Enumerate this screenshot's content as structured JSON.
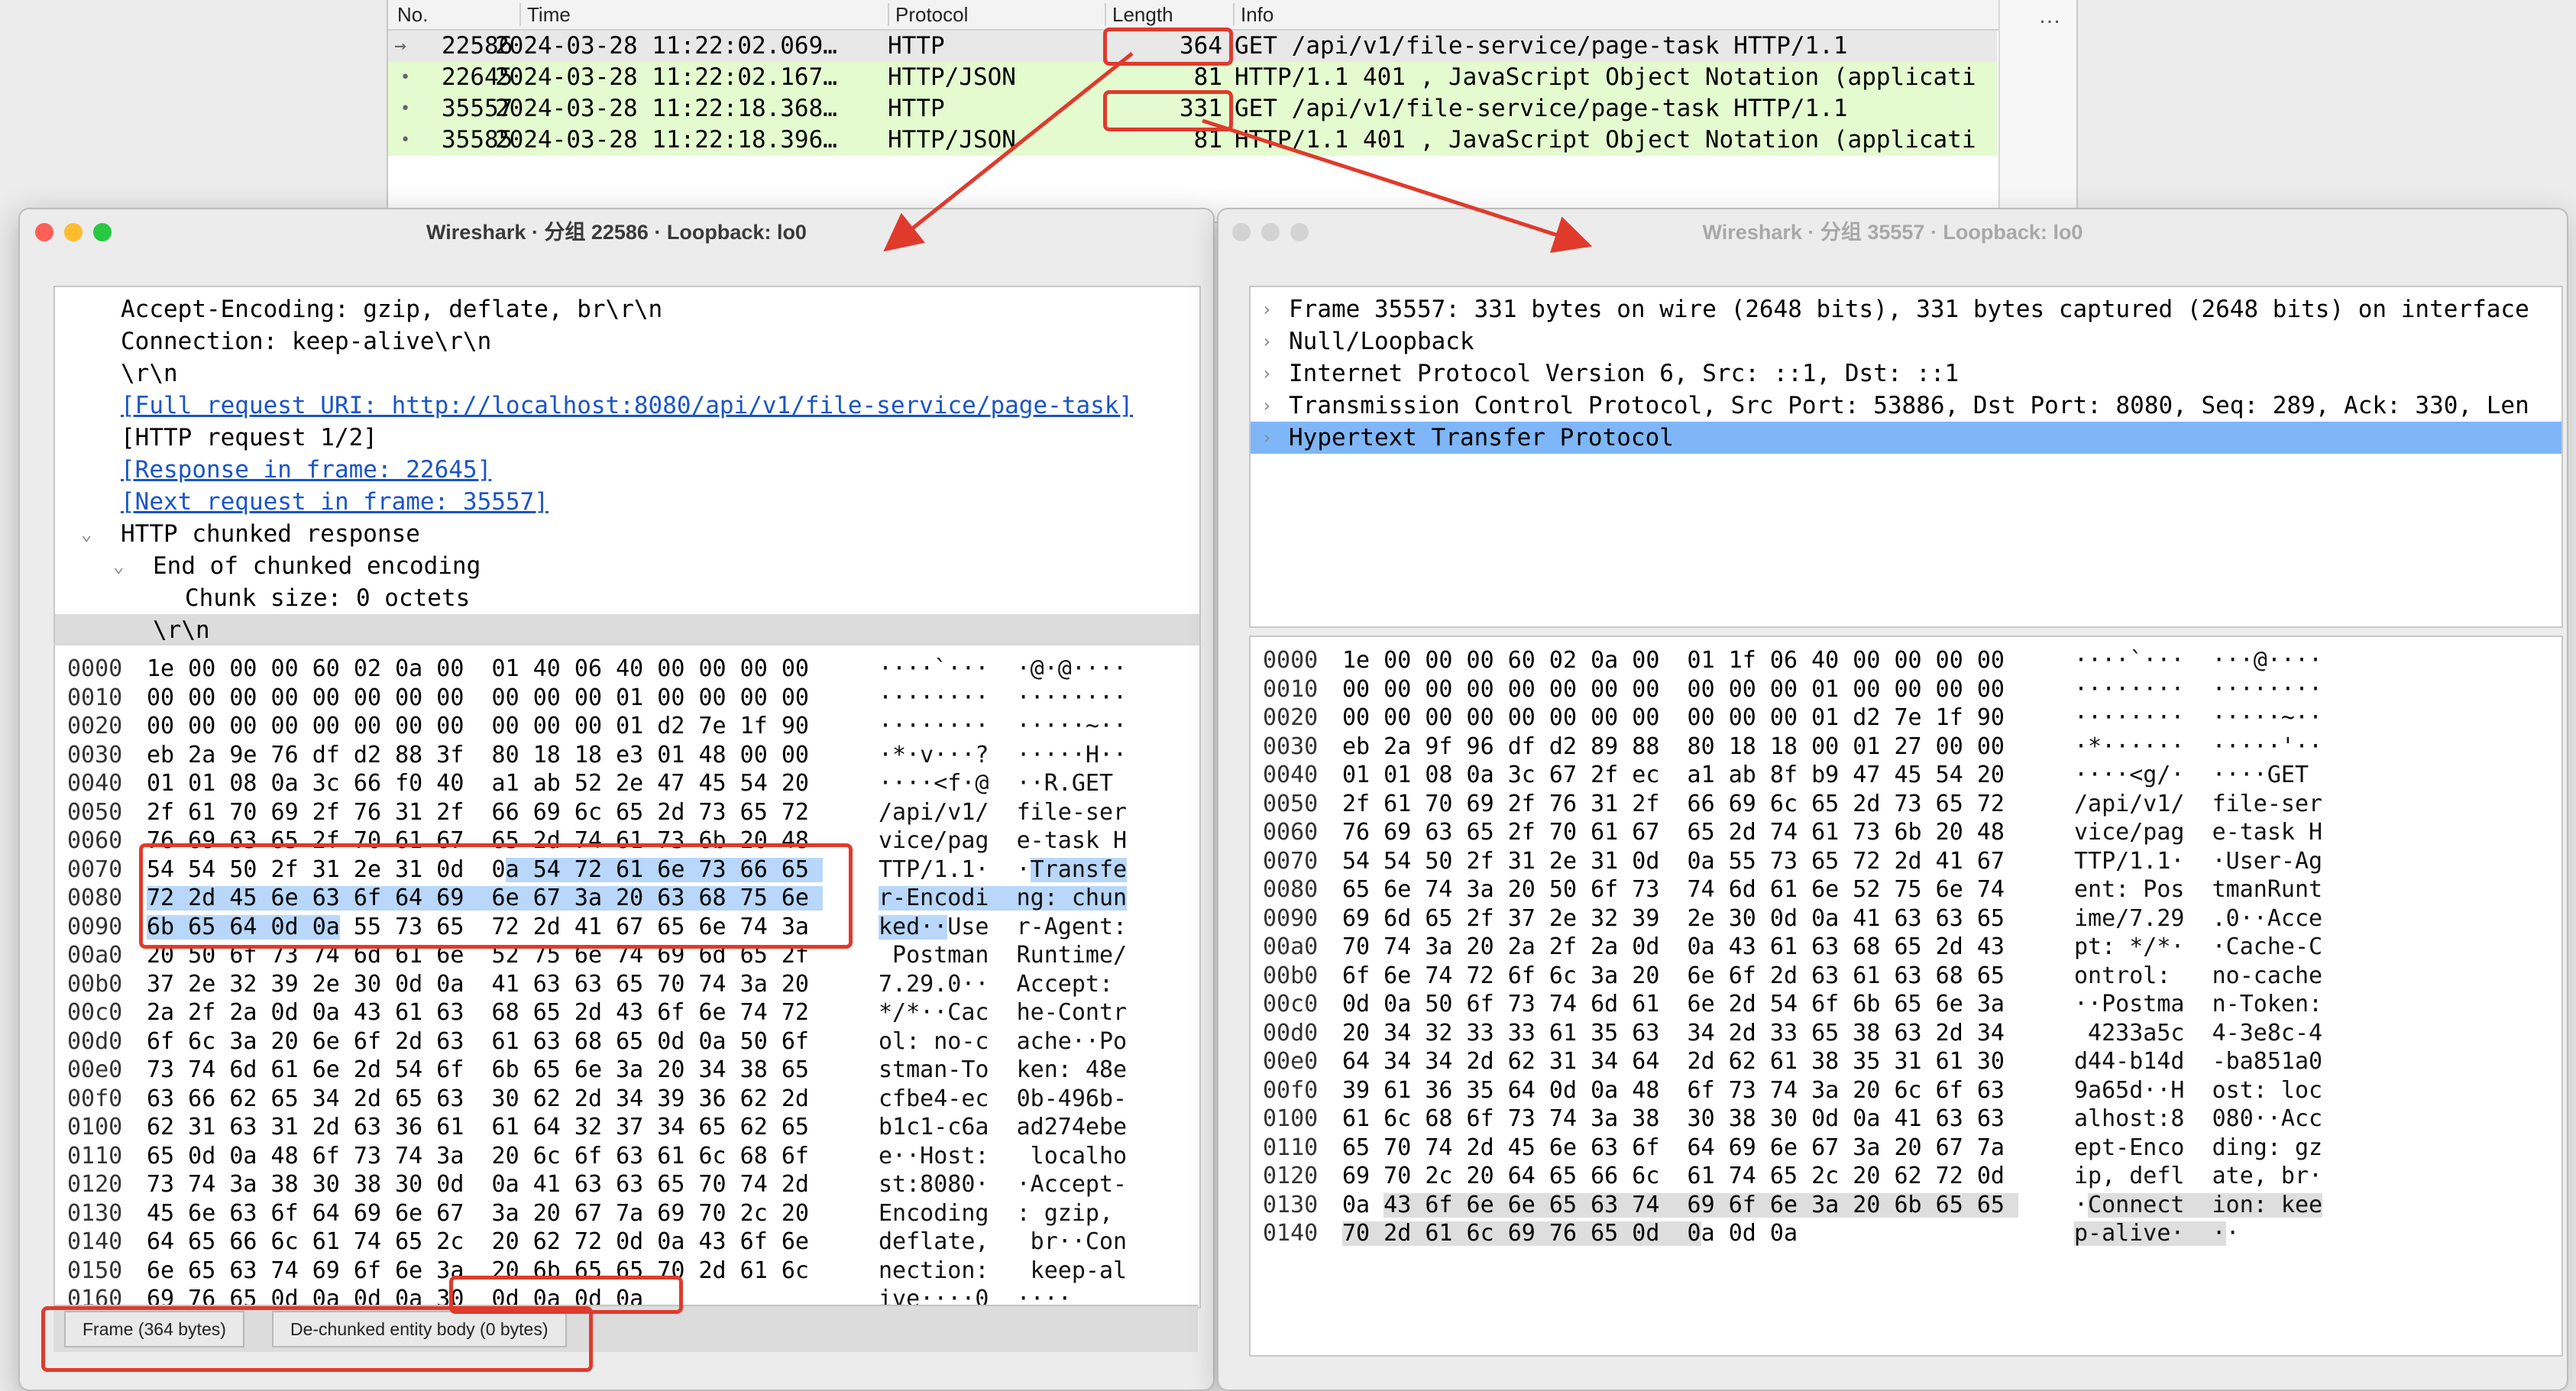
{
  "packet_list": {
    "columns": [
      "No.",
      "Time",
      "Protocol",
      "Length",
      "Info"
    ],
    "rows": [
      {
        "no": "22586",
        "time": "2024-03-28 11:22:02.069…",
        "protocol": "HTTP",
        "length": "364",
        "info": "GET /api/v1/file-service/page-task HTTP/1.1",
        "selected": true
      },
      {
        "no": "22645",
        "time": "2024-03-28 11:22:02.167…",
        "protocol": "HTTP/JSON",
        "length": "81",
        "info": "HTTP/1.1 401  , JavaScript Object Notation (applicati"
      },
      {
        "no": "35557",
        "time": "2024-03-28 11:22:18.368…",
        "protocol": "HTTP",
        "length": "331",
        "info": "GET /api/v1/file-service/page-task HTTP/1.1"
      },
      {
        "no": "35585",
        "time": "2024-03-28 11:22:18.396…",
        "protocol": "HTTP/JSON",
        "length": "81",
        "info": "HTTP/1.1 401  , JavaScript Object Notation (applicati"
      }
    ],
    "more": "…"
  },
  "colors": {
    "accent_red": "#e03a2c",
    "row_green": "#e4fbd0",
    "selection_blue": "#7fb6f7",
    "link_blue": "#1a55c8"
  },
  "left_window": {
    "title": "Wireshark · 分组 22586 · Loopback: lo0",
    "tree": [
      {
        "text": "Accept-Encoding: gzip, deflate, br\\r\\n",
        "indent": 1
      },
      {
        "text": "Connection: keep-alive\\r\\n",
        "indent": 1
      },
      {
        "text": "\\r\\n",
        "indent": 1
      },
      {
        "text": "[Full request URI: http://localhost:8080/api/v1/file-service/page-task]",
        "indent": 1,
        "link": true
      },
      {
        "text": "[HTTP request 1/2]",
        "indent": 1
      },
      {
        "text": "[Response in frame: 22645]",
        "indent": 1,
        "link": true
      },
      {
        "text": "[Next request in frame: 35557]",
        "indent": 1,
        "link": true
      },
      {
        "text": "HTTP chunked response",
        "indent": 1,
        "expander": "down"
      },
      {
        "text": "End of chunked encoding",
        "indent": 2,
        "expander": "down"
      },
      {
        "text": "Chunk size: 0 octets",
        "indent": 3
      },
      {
        "text": "\\r\\n",
        "indent": 2,
        "highlight": true
      }
    ],
    "hex": [
      {
        "off": "0000",
        "hex": "1e 00 00 00 60 02 0a 00  01 40 06 40 00 00 00 00",
        "ascii": "····`···  ·@·@····"
      },
      {
        "off": "0010",
        "hex": "00 00 00 00 00 00 00 00  00 00 00 01 00 00 00 00",
        "ascii": "········  ········"
      },
      {
        "off": "0020",
        "hex": "00 00 00 00 00 00 00 00  00 00 00 01 d2 7e 1f 90",
        "ascii": "········  ·····~··"
      },
      {
        "off": "0030",
        "hex": "eb 2a 9e 76 df d2 88 3f  80 18 18 e3 01 48 00 00",
        "ascii": "·*·v···?  ·····H··"
      },
      {
        "off": "0040",
        "hex": "01 01 08 0a 3c 66 f0 40  a1 ab 52 2e 47 45 54 20",
        "ascii": "····<f·@  ··R.GET "
      },
      {
        "off": "0050",
        "hex": "2f 61 70 69 2f 76 31 2f  66 69 6c 65 2d 73 65 72",
        "ascii": "/api/v1/  file-ser"
      },
      {
        "off": "0060",
        "hex": "76 69 63 65 2f 70 61 67  65 2d 74 61 73 6b 20 48",
        "ascii": "vice/pag  e-task H"
      },
      {
        "off": "0070",
        "hex": "54 54 50 2f 31 2e 31 0d  0a 54 72 61 6e 73 66 65",
        "ascii": "TTP/1.1·  ·Transfe",
        "hl": "partial"
      },
      {
        "off": "0080",
        "hex": "72 2d 45 6e 63 6f 64 69  6e 67 3a 20 63 68 75 6e",
        "ascii": "r-Encodi  ng: chun",
        "hl": "full"
      },
      {
        "off": "0090",
        "hex": "6b 65 64 0d 0a 55 73 65  72 2d 41 67 65 6e 74 3a",
        "ascii": "ked··Use  r-Agent:",
        "hl": "start"
      },
      {
        "off": "00a0",
        "hex": "20 50 6f 73 74 6d 61 6e  52 75 6e 74 69 6d 65 2f",
        "ascii": " Postman  Runtime/"
      },
      {
        "off": "00b0",
        "hex": "37 2e 32 39 2e 30 0d 0a  41 63 63 65 70 74 3a 20",
        "ascii": "7.29.0··  Accept: "
      },
      {
        "off": "00c0",
        "hex": "2a 2f 2a 0d 0a 43 61 63  68 65 2d 43 6f 6e 74 72",
        "ascii": "*/*··Cac  he-Contr"
      },
      {
        "off": "00d0",
        "hex": "6f 6c 3a 20 6e 6f 2d 63  61 63 68 65 0d 0a 50 6f",
        "ascii": "ol: no-c  ache··Po"
      },
      {
        "off": "00e0",
        "hex": "73 74 6d 61 6e 2d 54 6f  6b 65 6e 3a 20 34 38 65",
        "ascii": "stman-To  ken: 48e"
      },
      {
        "off": "00f0",
        "hex": "63 66 62 65 34 2d 65 63  30 62 2d 34 39 36 62 2d",
        "ascii": "cfbe4-ec  0b-496b-"
      },
      {
        "off": "0100",
        "hex": "62 31 63 31 2d 63 36 61  61 64 32 37 34 65 62 65",
        "ascii": "b1c1-c6a  ad274ebe"
      },
      {
        "off": "0110",
        "hex": "65 0d 0a 48 6f 73 74 3a  20 6c 6f 63 61 6c 68 6f",
        "ascii": "e··Host:   localho"
      },
      {
        "off": "0120",
        "hex": "73 74 3a 38 30 38 30 0d  0a 41 63 63 65 70 74 2d",
        "ascii": "st:8080·  ·Accept-"
      },
      {
        "off": "0130",
        "hex": "45 6e 63 6f 64 69 6e 67  3a 20 67 7a 69 70 2c 20",
        "ascii": "Encoding  : gzip, "
      },
      {
        "off": "0140",
        "hex": "64 65 66 6c 61 74 65 2c  20 62 72 0d 0a 43 6f 6e",
        "ascii": "deflate,   br··Con"
      },
      {
        "off": "0150",
        "hex": "6e 65 63 74 69 6f 6e 3a  20 6b 65 65 70 2d 61 6c",
        "ascii": "nection:   keep-al"
      },
      {
        "off": "0160",
        "hex": "69 76 65 0d 0a 0d 0a 30  0d 0a 0d 0a",
        "ascii": "ive····0  ····"
      }
    ],
    "tabs": [
      "Frame (364 bytes)",
      "De-chunked entity body (0 bytes)"
    ]
  },
  "right_window": {
    "title": "Wireshark · 分组 35557 · Loopback: lo0",
    "tree": [
      {
        "text": "Frame 35557: 331 bytes on wire (2648 bits), 331 bytes captured (2648 bits) on interface"
      },
      {
        "text": "Null/Loopback"
      },
      {
        "text": "Internet Protocol Version 6, Src: ::1, Dst: ::1"
      },
      {
        "text": "Transmission Control Protocol, Src Port: 53886, Dst Port: 8080, Seq: 289, Ack: 330, Len"
      },
      {
        "text": "Hypertext Transfer Protocol",
        "selected": true
      }
    ],
    "hex": [
      {
        "off": "0000",
        "hex": "1e 00 00 00 60 02 0a 00  01 1f 06 40 00 00 00 00",
        "ascii": "····`···  ···@····"
      },
      {
        "off": "0010",
        "hex": "00 00 00 00 00 00 00 00  00 00 00 01 00 00 00 00",
        "ascii": "········  ········"
      },
      {
        "off": "0020",
        "hex": "00 00 00 00 00 00 00 00  00 00 00 01 d2 7e 1f 90",
        "ascii": "········  ·····~··"
      },
      {
        "off": "0030",
        "hex": "eb 2a 9f 96 df d2 89 88  80 18 18 00 01 27 00 00",
        "ascii": "·*······  ·····'··"
      },
      {
        "off": "0040",
        "hex": "01 01 08 0a 3c 67 2f ec  a1 ab 8f b9 47 45 54 20",
        "ascii": "····<g/·  ····GET "
      },
      {
        "off": "0050",
        "hex": "2f 61 70 69 2f 76 31 2f  66 69 6c 65 2d 73 65 72",
        "ascii": "/api/v1/  file-ser"
      },
      {
        "off": "0060",
        "hex": "76 69 63 65 2f 70 61 67  65 2d 74 61 73 6b 20 48",
        "ascii": "vice/pag  e-task H"
      },
      {
        "off": "0070",
        "hex": "54 54 50 2f 31 2e 31 0d  0a 55 73 65 72 2d 41 67",
        "ascii": "TTP/1.1·  ·User-Ag"
      },
      {
        "off": "0080",
        "hex": "65 6e 74 3a 20 50 6f 73  74 6d 61 6e 52 75 6e 74",
        "ascii": "ent: Pos  tmanRunt"
      },
      {
        "off": "0090",
        "hex": "69 6d 65 2f 37 2e 32 39  2e 30 0d 0a 41 63 63 65",
        "ascii": "ime/7.29  .0··Acce"
      },
      {
        "off": "00a0",
        "hex": "70 74 3a 20 2a 2f 2a 0d  0a 43 61 63 68 65 2d 43",
        "ascii": "pt: */*·  ·Cache-C"
      },
      {
        "off": "00b0",
        "hex": "6f 6e 74 72 6f 6c 3a 20  6e 6f 2d 63 61 63 68 65",
        "ascii": "ontrol:   no-cache"
      },
      {
        "off": "00c0",
        "hex": "0d 0a 50 6f 73 74 6d 61  6e 2d 54 6f 6b 65 6e 3a",
        "ascii": "··Postma  n-Token:"
      },
      {
        "off": "00d0",
        "hex": "20 34 32 33 33 61 35 63  34 2d 33 65 38 63 2d 34",
        "ascii": " 4233a5c  4-3e8c-4"
      },
      {
        "off": "00e0",
        "hex": "64 34 34 2d 62 31 34 64  2d 62 61 38 35 31 61 30",
        "ascii": "d44-b14d  -ba851a0"
      },
      {
        "off": "00f0",
        "hex": "39 61 36 35 64 0d 0a 48  6f 73 74 3a 20 6c 6f 63",
        "ascii": "9a65d··H  ost: loc"
      },
      {
        "off": "0100",
        "hex": "61 6c 68 6f 73 74 3a 38  30 38 30 0d 0a 41 63 63",
        "ascii": "alhost:8  080··Acc"
      },
      {
        "off": "0110",
        "hex": "65 70 74 2d 45 6e 63 6f  64 69 6e 67 3a 20 67 7a",
        "ascii": "ept-Enco  ding: gz"
      },
      {
        "off": "0120",
        "hex": "69 70 2c 20 64 65 66 6c  61 74 65 2c 20 62 72 0d",
        "ascii": "ip, defl  ate, br·"
      },
      {
        "off": "0130",
        "hex": "0a 43 6f 6e 6e 65 63 74  69 6f 6e 3a 20 6b 65 65",
        "ascii": "·Connect  ion: kee",
        "hl": "grey-from1"
      },
      {
        "off": "0140",
        "hex": "70 2d 61 6c 69 76 65 0d  0a 0d 0a",
        "ascii": "p-alive·  ··",
        "hl": "grey-to9"
      }
    ]
  }
}
